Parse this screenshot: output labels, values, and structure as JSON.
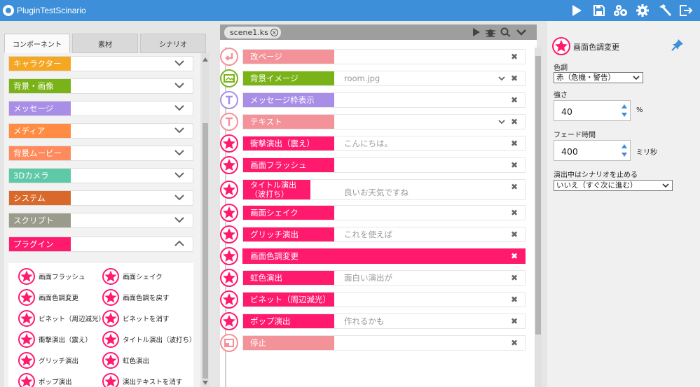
{
  "app": {
    "title": "PluginTestScinario"
  },
  "toolbar": {
    "icons": [
      "play-icon",
      "save-icon",
      "settings-group-icon",
      "gear-icon",
      "build-hammer-icon",
      "exit-icon"
    ]
  },
  "left": {
    "tabs": [
      {
        "label": "コンポーネント",
        "active": true
      },
      {
        "label": "素材",
        "active": false
      },
      {
        "label": "シナリオ",
        "active": false
      }
    ],
    "categories": [
      {
        "label": "キャラクター",
        "color": "#f5a623"
      },
      {
        "label": "背景・画像",
        "color": "#7ab317"
      },
      {
        "label": "メッセージ",
        "color": "#a98ee8"
      },
      {
        "label": "メディア",
        "color": "#ff8c42"
      },
      {
        "label": "背景ムービー",
        "color": "#ff8a5c"
      },
      {
        "label": "3Dカメラ",
        "color": "#5ec9a6"
      },
      {
        "label": "システム",
        "color": "#d9692a"
      },
      {
        "label": "スクリプト",
        "color": "#9b9b8c"
      },
      {
        "label": "プラグイン",
        "color": "#ff1a6e"
      }
    ],
    "plugins": [
      "画面フラッシュ",
      "画面シェイク",
      "画面色調変更",
      "画面色調を戻す",
      "ビネット（周辺減光）",
      "ビネットを消す",
      "衝撃演出（震え）",
      "タイトル演出（波打ち）",
      "グリッチ演出",
      "虹色演出",
      "ポップ演出",
      "演出テキストを消す"
    ]
  },
  "center": {
    "file_tab": "scene1.ks",
    "rows": [
      {
        "tag": "改ページ",
        "color": "#f4929a",
        "value": "",
        "dropdown": false,
        "icon": "page-break-icon"
      },
      {
        "tag": "背景イメージ",
        "color": "#7ab317",
        "value": "room.jpg",
        "dropdown": true,
        "icon": "bg-image-icon"
      },
      {
        "tag": "メッセージ枠表示",
        "color": "#a98ee8",
        "value": "",
        "dropdown": false,
        "icon": "message-frame-icon"
      },
      {
        "tag": "テキスト",
        "color": "#f4929a",
        "value": "",
        "dropdown": true,
        "icon": "text-icon"
      },
      {
        "tag": "衝撃演出（震え）",
        "color": "#ff1a6e",
        "value": "こんにちは。",
        "dropdown": false,
        "icon": "star-icon"
      },
      {
        "tag": "画面フラッシュ",
        "color": "#ff1a6e",
        "value": "",
        "dropdown": false,
        "icon": "star-icon"
      },
      {
        "tag": "タイトル演出（波打ち）",
        "color": "#ff1a6e",
        "value": "良いお天気ですね",
        "dropdown": false,
        "icon": "star-icon"
      },
      {
        "tag": "画面シェイク",
        "color": "#ff1a6e",
        "value": "",
        "dropdown": false,
        "icon": "star-icon"
      },
      {
        "tag": "グリッチ演出",
        "color": "#ff1a6e",
        "value": "これを使えば",
        "dropdown": false,
        "icon": "star-icon"
      },
      {
        "tag": "画面色調変更",
        "color": "#ff1a6e",
        "value": "",
        "dropdown": false,
        "icon": "star-icon",
        "selected": true
      },
      {
        "tag": "虹色演出",
        "color": "#ff1a6e",
        "value": "面白い演出が",
        "dropdown": false,
        "icon": "star-icon"
      },
      {
        "tag": "ビネット（周辺減光）",
        "color": "#ff1a6e",
        "value": "",
        "dropdown": false,
        "icon": "star-icon"
      },
      {
        "tag": "ポップ演出",
        "color": "#ff1a6e",
        "value": "作れるかも",
        "dropdown": false,
        "icon": "star-icon"
      },
      {
        "tag": "停止",
        "color": "#f4929a",
        "value": "",
        "dropdown": false,
        "icon": "stop-icon"
      }
    ]
  },
  "right": {
    "title": "画面色調変更",
    "tone_label": "色調",
    "tone_value": "赤（危機・警告）",
    "strength_label": "強さ",
    "strength_value": "40",
    "strength_unit": "%",
    "fade_label": "フェード時間",
    "fade_value": "400",
    "fade_unit": "ミリ秒",
    "stop_label": "演出中はシナリオを止める",
    "stop_value": "いいえ（すぐ次に進む）"
  }
}
